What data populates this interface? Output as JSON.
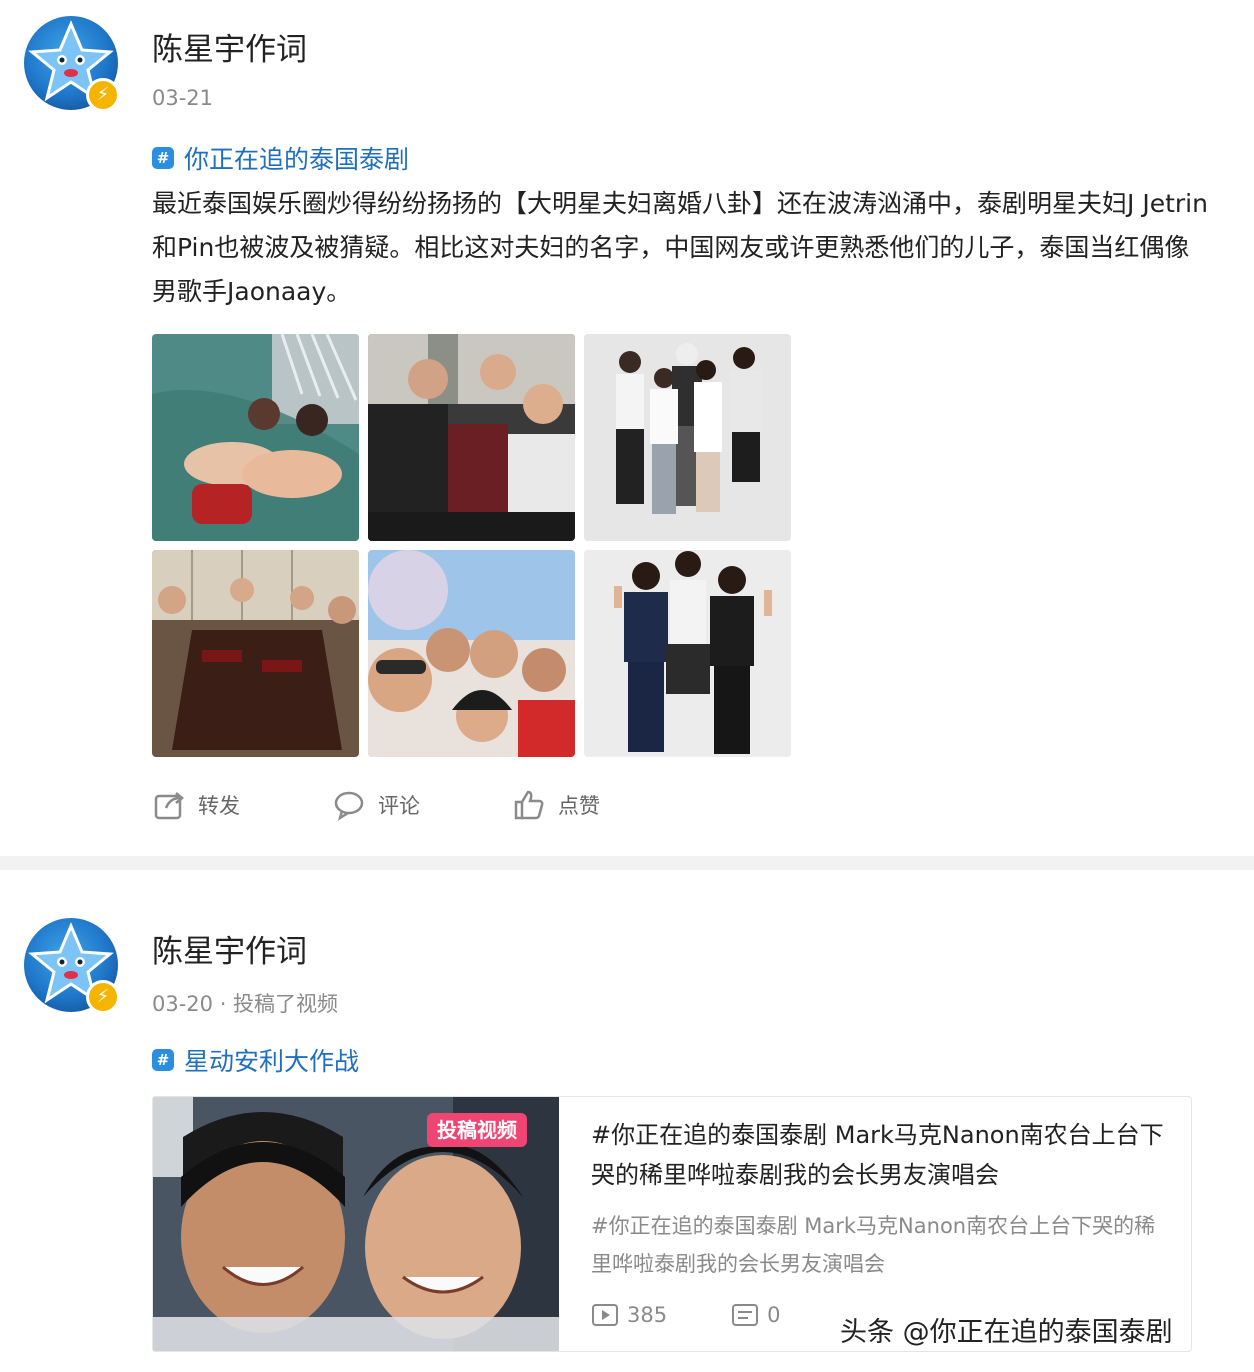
{
  "posts": [
    {
      "author": "陈星宇作词",
      "meta": "03-21",
      "topic": "你正在追的泰国泰剧",
      "text": "最近泰国娱乐圈炒得纷纷扬扬的【大明星夫妇离婚八卦】还在波涛汹涌中，泰剧明星夫妇J Jetrin和Pin也被波及被猜疑。相比这对夫妇的名字，中国网友或许更熟悉他们的儿子，泰国当红偶像男歌手Jaonaay。",
      "photos": [
        "family-pool-photo",
        "family-group-photo",
        "family-white-backdrop-photo",
        "family-dinner-photo",
        "family-selfie-photo",
        "brothers-suits-photo"
      ],
      "actions": {
        "repost": "转发",
        "comment": "评论",
        "like": "点赞"
      }
    },
    {
      "author": "陈星宇作词",
      "meta": "03-20 · 投稿了视频",
      "topic": "星动安利大作战",
      "video": {
        "badge": "投稿视频",
        "title": "#你正在追的泰国泰剧 Mark马克Nanon南农台上台下哭的稀里哗啦泰剧我的会长男友演唱会",
        "description": "#你正在追的泰国泰剧 Mark马克Nanon南农台上台下哭的稀里哗啦泰剧我的会长男友演唱会",
        "plays": "385",
        "comments": "0"
      }
    }
  ],
  "watermark": "头条 @你正在追的泰国泰剧",
  "colors": {
    "link": "#1f6fbf",
    "badge": "#f04472",
    "verify": "#f5b400",
    "separator": "#f2f2f2"
  }
}
